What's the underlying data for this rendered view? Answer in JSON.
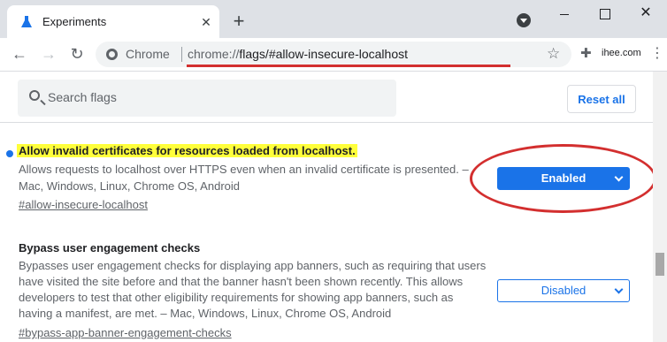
{
  "tab": {
    "title": "Experiments",
    "close": "✕"
  },
  "new_tab": "+",
  "window": {
    "close": "✕"
  },
  "toolbar": {
    "back": "←",
    "forward": "→",
    "reload": "↻",
    "site_name": "Chrome",
    "url_scheme": "chrome://",
    "url_rest": "flags/#allow-insecure-localhost",
    "star": "☆",
    "profile": "ihee.com",
    "menu": "⋮"
  },
  "search": {
    "placeholder": "Search flags"
  },
  "reset_label": "Reset all",
  "flags": [
    {
      "title": "Allow invalid certificates for resources loaded from localhost.",
      "desc_line1": "Allows requests to localhost over HTTPS even when an invalid certificate is presented. –",
      "desc_line2": "Mac, Windows, Linux, Chrome OS, Android",
      "link": "#allow-insecure-localhost",
      "value": "Enabled"
    },
    {
      "title": "Bypass user engagement checks",
      "desc_line1": "Bypasses user engagement checks for displaying app banners, such as requiring that users",
      "desc_line2": "have visited the site before and that the banner hasn't been shown recently. This allows",
      "desc_line3": "developers to test that other eligibility requirements for showing app banners, such as",
      "desc_line4": "having a manifest, are met. – Mac, Windows, Linux, Chrome OS, Android",
      "link": "#bypass-app-banner-engagement-checks",
      "value": "Disabled"
    }
  ],
  "colors": {
    "accent": "#1a73e8",
    "highlight": "#ffff3b",
    "annotation": "#d32f2f"
  }
}
